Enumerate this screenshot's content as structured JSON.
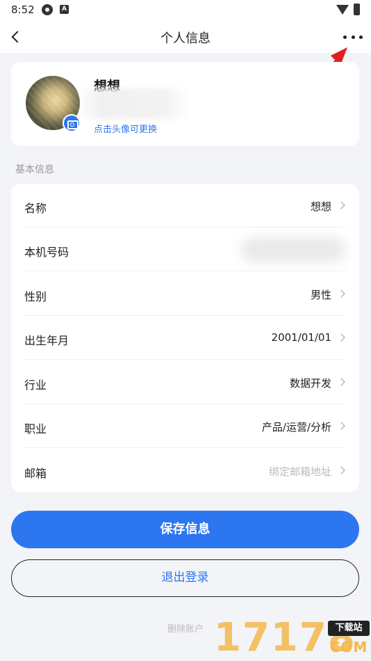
{
  "status_bar": {
    "time": "8:52",
    "notif_badge": "A"
  },
  "nav": {
    "title": "个人信息"
  },
  "profile": {
    "name": "想想",
    "change_hint": "点击头像可更换"
  },
  "section_title": "基本信息",
  "rows": [
    {
      "label": "名称",
      "value": "想想"
    },
    {
      "label": "本机号码",
      "value": ""
    },
    {
      "label": "性别",
      "value": "男性"
    },
    {
      "label": "出生年月",
      "value": "2001/01/01"
    },
    {
      "label": "行业",
      "value": "数据开发"
    },
    {
      "label": "职业",
      "value": "产品/运营/分析"
    },
    {
      "label": "邮箱",
      "value": "绑定邮箱地址"
    }
  ],
  "buttons": {
    "save": "保存信息",
    "logout": "退出登录",
    "delete": "删除账户"
  },
  "watermark": {
    "digits": "17178",
    "badge": "下载站",
    "domain": "COM"
  },
  "colors": {
    "accent": "#2c76f0",
    "annotation_arrow": "#e02020"
  }
}
